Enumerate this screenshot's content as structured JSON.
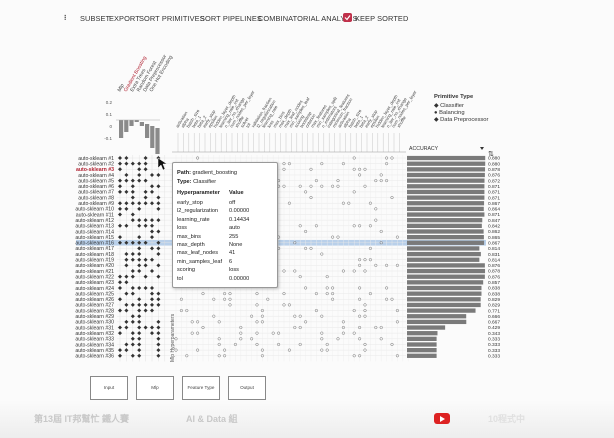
{
  "toolbar": {
    "subset": "SUBSET",
    "export": "EXPORT",
    "sort_primitives": "SORT PRIMITIVES",
    "sort_pipelines": "SORT PIPELINES",
    "combinatorial": "COMBINATORIAL ANALYSIS",
    "keep_sorted": "KEEP SORTED",
    "keep_sorted_checked": true
  },
  "pipelines": [
    "auto-sklearn #1",
    "auto-sklearn #2",
    "auto-sklearn #3",
    "auto-sklearn #4",
    "auto-sklearn #5",
    "auto-sklearn #6",
    "auto-sklearn #7",
    "auto-sklearn #8",
    "auto-sklearn #9",
    "auto-sklearn #10",
    "auto-sklearn #11",
    "auto-sklearn #12",
    "auto-sklearn #13",
    "auto-sklearn #14",
    "auto-sklearn #15",
    "auto-sklearn #16",
    "auto-sklearn #17",
    "auto-sklearn #18",
    "auto-sklearn #19",
    "auto-sklearn #20",
    "auto-sklearn #21",
    "auto-sklearn #22",
    "auto-sklearn #23",
    "auto-sklearn #24",
    "auto-sklearn #25",
    "auto-sklearn #26",
    "auto-sklearn #27",
    "auto-sklearn #28",
    "auto-sklearn #29",
    "auto-sklearn #30",
    "auto-sklearn #31",
    "auto-sklearn #32",
    "auto-sklearn #33",
    "auto-sklearn #34",
    "auto-sklearn #35",
    "auto-sklearn #36"
  ],
  "highlighted_row": 2,
  "selected_row": 15,
  "importance_scale": [
    "0.2",
    "0.1",
    "0",
    "-0.1"
  ],
  "primitive_headers": [
    "Mlp",
    "Gradient Boosting",
    "Extra Trees",
    "Random Forest",
    "Data Preprocessor",
    "One Hot Encoding"
  ],
  "accuracy": {
    "label": "ACCURACY",
    "values": [
      "0.880",
      "0.880",
      "0.878",
      "0.876",
      "0.872",
      "0.871",
      "0.871",
      "0.871",
      "0.867",
      "0.864",
      "0.871",
      "0.847",
      "0.842",
      "0.862",
      "0.865",
      "0.867",
      "0.814",
      "0.831",
      "0.814",
      "0.876",
      "0.878",
      "0.876",
      "0.857",
      "0.838",
      "0.838",
      "0.829",
      "0.829",
      "0.771",
      "0.666",
      "0.667",
      "0.429",
      "0.343",
      "0.333",
      "0.333",
      "0.333",
      "0.333"
    ],
    "scores": [
      0.88,
      0.88,
      0.878,
      0.876,
      0.872,
      0.871,
      0.871,
      0.871,
      0.867,
      0.864,
      0.871,
      0.847,
      0.842,
      0.862,
      0.865,
      0.867,
      0.814,
      0.831,
      0.814,
      0.876,
      0.878,
      0.876,
      0.857,
      0.838,
      0.838,
      0.829,
      0.829,
      0.771,
      0.666,
      0.667,
      0.429,
      0.343,
      0.333,
      0.333,
      0.333,
      0.333
    ]
  },
  "tooltip": {
    "path_label": "Path:",
    "path_value": "gradient_boosting",
    "type_label": "Type:",
    "type_value": "Classifier",
    "col_param": "Hyperparameter",
    "col_value": "Value",
    "rows": [
      {
        "k": "early_stop",
        "v": "off"
      },
      {
        "k": "l2_regularization",
        "v": "0.00000"
      },
      {
        "k": "learning_rate",
        "v": "0.14434"
      },
      {
        "k": "loss",
        "v": "auto"
      },
      {
        "k": "max_bins",
        "v": "255"
      },
      {
        "k": "max_depth",
        "v": "None"
      },
      {
        "k": "max_leaf_nodes",
        "v": "41"
      },
      {
        "k": "min_samples_leaf",
        "v": "6"
      },
      {
        "k": "scoring",
        "v": "loss"
      },
      {
        "k": "tol",
        "v": "0.00000"
      }
    ]
  },
  "legend": {
    "title": "Primitive Type",
    "items": [
      "Classifier",
      "Balancing",
      "Data Preprocessor"
    ]
  },
  "axis_label": "Mlp Hyperparameters",
  "flow": [
    "Input",
    "Mlp",
    "Feature Type",
    "Output"
  ],
  "footer": {
    "left": "第13屆 IT邦幫忙 鐵人賽",
    "mid": "AI & Data 組",
    "channel": "10程式中"
  },
  "colors": {
    "accent": "#c0304a",
    "bar": "#7a7a7a",
    "selected": "#a9c6e6",
    "highlight": "#b02030"
  }
}
